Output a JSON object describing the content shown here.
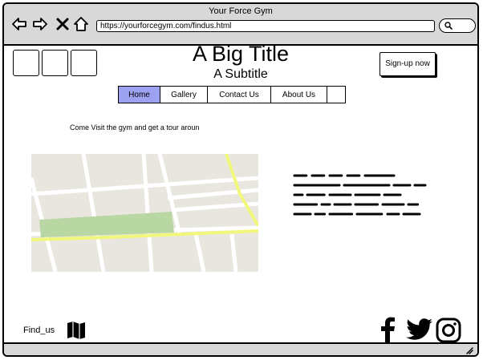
{
  "browser": {
    "window_title": "Your Force Gym",
    "url": "https://yourforcegym.com/findus.html",
    "icons": [
      "back-arrow-icon",
      "forward-arrow-icon",
      "close-icon",
      "home-icon",
      "search-icon"
    ]
  },
  "header": {
    "title": "A Big Title",
    "subtitle": "A Subtitle",
    "signup_label": "Sign-up now"
  },
  "nav": {
    "tabs": [
      {
        "label": "Home",
        "active": true
      },
      {
        "label": "Gallery",
        "active": false
      },
      {
        "label": "Contact Us",
        "active": false
      },
      {
        "label": "About Us",
        "active": false
      }
    ]
  },
  "main": {
    "intro": "Come Visit the gym and get a tour aroun"
  },
  "footer": {
    "find_us": "Find_us",
    "icons": [
      "map-icon",
      "facebook-icon",
      "twitter-icon",
      "instagram-icon"
    ]
  },
  "colors": {
    "chrome": "#d8d8d8",
    "active_tab": "#9da2f0",
    "map_bg": "#e8e6df",
    "map_road": "#ffffff",
    "map_highlight_road": "#f1f77a",
    "map_park": "#b9d7a2"
  }
}
